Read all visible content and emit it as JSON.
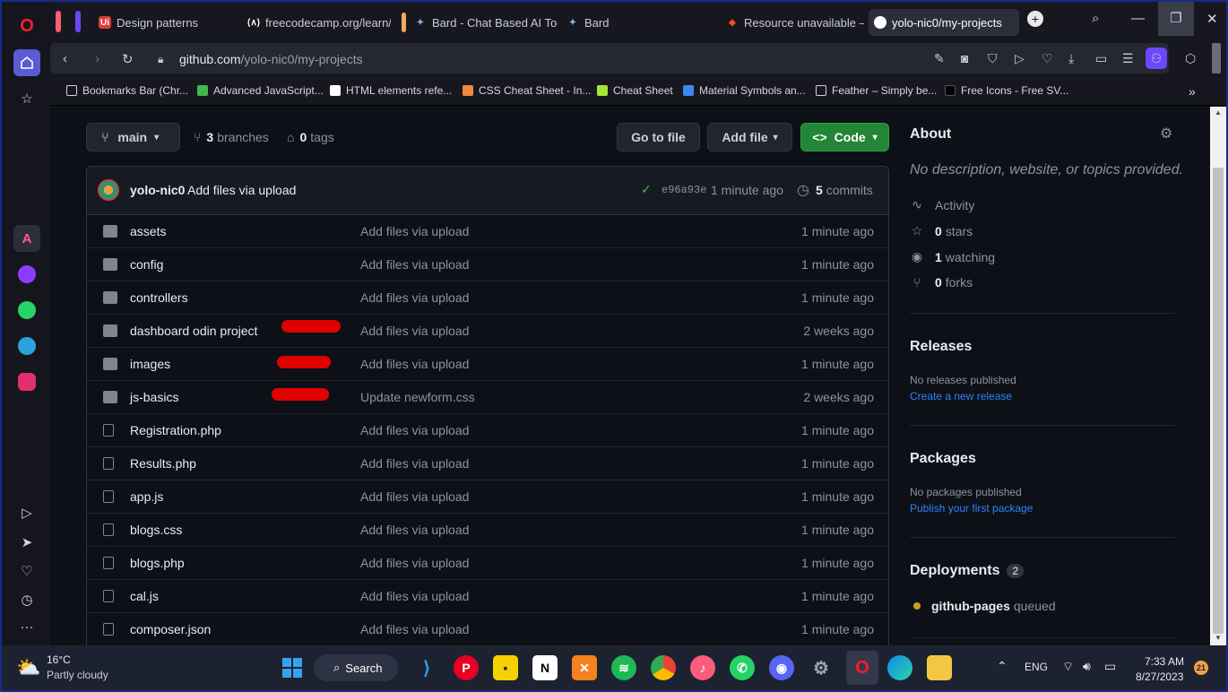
{
  "browser": {
    "tabs": [
      {
        "label": "Design patterns",
        "icon": "uipath-icon",
        "color": "#e03b3b"
      },
      {
        "label": "freecodecamp.org/learn/j",
        "icon": "freecodecamp-icon",
        "color": "#ffffff"
      },
      {
        "label": "Bard - Chat Based AI Tool",
        "icon": "bard-icon",
        "color": "#8ab4f8"
      },
      {
        "label": "Bard",
        "icon": "bard-icon",
        "color": "#8ab4f8"
      },
      {
        "label": "Resource unavailable – Fig",
        "icon": "figma-icon",
        "color": "#f24e1e"
      },
      {
        "label": "yolo-nic0/my-projects",
        "icon": "github-icon",
        "color": "#ffffff"
      }
    ],
    "url_domain": "github.com",
    "url_path": "/yolo-nic0/my-projects",
    "bookmarks": [
      {
        "label": "Bookmarks Bar (Chr...",
        "color": "#cfd3e0"
      },
      {
        "label": "Advanced JavaScript...",
        "color": "#3fb950"
      },
      {
        "label": "HTML elements refe...",
        "color": "#ffffff"
      },
      {
        "label": "CSS Cheat Sheet - In...",
        "color": "#f0883e"
      },
      {
        "label": "Cheat Sheet",
        "color": "#a3e635"
      },
      {
        "label": "Material Symbols an...",
        "color": "#4285f4"
      },
      {
        "label": "Feather – Simply be...",
        "color": "#cfd3e0"
      },
      {
        "label": "Free Icons - Free SV...",
        "color": "#111111"
      }
    ]
  },
  "repo": {
    "branch": "main",
    "branches_count": "3",
    "branches_label": "branches",
    "tags_count": "0",
    "tags_label": "tags",
    "go_to_file": "Go to file",
    "add_file": "Add file",
    "code": "Code",
    "commit": {
      "author": "yolo-nic0",
      "message": "Add files via upload",
      "sha": "e96a93e",
      "time": "1 minute ago",
      "commits_count": "5",
      "commits_label": "commits"
    },
    "files": [
      {
        "type": "folder",
        "name": "assets",
        "message": "Add files via upload",
        "time": "1 minute ago"
      },
      {
        "type": "folder",
        "name": "config",
        "message": "Add files via upload",
        "time": "1 minute ago"
      },
      {
        "type": "folder",
        "name": "controllers",
        "message": "Add files via upload",
        "time": "1 minute ago"
      },
      {
        "type": "folder",
        "name": "dashboard odin project",
        "message": "Add files via upload",
        "time": "2 weeks ago"
      },
      {
        "type": "folder",
        "name": "images",
        "message": "Add files via upload",
        "time": "1 minute ago"
      },
      {
        "type": "folder",
        "name": "js-basics",
        "message": "Update newform.css",
        "time": "2 weeks ago"
      },
      {
        "type": "file",
        "name": "Registration.php",
        "message": "Add files via upload",
        "time": "1 minute ago"
      },
      {
        "type": "file",
        "name": "Results.php",
        "message": "Add files via upload",
        "time": "1 minute ago"
      },
      {
        "type": "file",
        "name": "app.js",
        "message": "Add files via upload",
        "time": "1 minute ago"
      },
      {
        "type": "file",
        "name": "blogs.css",
        "message": "Add files via upload",
        "time": "1 minute ago"
      },
      {
        "type": "file",
        "name": "blogs.php",
        "message": "Add files via upload",
        "time": "1 minute ago"
      },
      {
        "type": "file",
        "name": "cal.js",
        "message": "Add files via upload",
        "time": "1 minute ago"
      },
      {
        "type": "file",
        "name": "composer.json",
        "message": "Add files via upload",
        "time": "1 minute ago"
      }
    ]
  },
  "about": {
    "title": "About",
    "description": "No description, website, or topics provided.",
    "activity": "Activity",
    "stars_count": "0",
    "stars_label": "stars",
    "watching_count": "1",
    "watching_label": "watching",
    "forks_count": "0",
    "forks_label": "forks",
    "releases_title": "Releases",
    "releases_text": "No releases published",
    "releases_link": "Create a new release",
    "packages_title": "Packages",
    "packages_text": "No packages published",
    "packages_link": "Publish your first package",
    "deployments_title": "Deployments",
    "deployments_count": "2",
    "deployment_name": "github-pages",
    "deployment_status": "queued"
  },
  "taskbar": {
    "temperature": "16°C",
    "weather": "Partly cloudy",
    "search": "Search",
    "language": "ENG",
    "time": "7:33 AM",
    "date": "8/27/2023",
    "notifications": "21"
  }
}
